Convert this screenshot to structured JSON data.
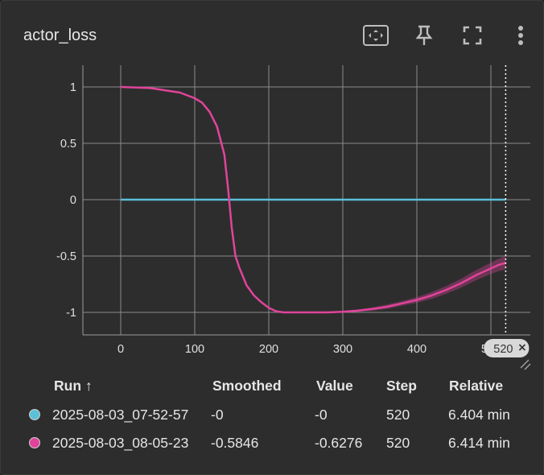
{
  "card": {
    "title": "actor_loss"
  },
  "toolbar": {
    "fit_icon": "fit-domain-icon",
    "pin_icon": "pin-icon",
    "fullscreen_icon": "fullscreen-icon",
    "more_icon": "more-vert-icon"
  },
  "chart_data": {
    "type": "line",
    "title": "actor_loss",
    "xlabel": "",
    "ylabel": "",
    "xlim": [
      -50,
      550
    ],
    "ylim": [
      -1.2,
      1.2
    ],
    "x_ticks": [
      "0",
      "100",
      "200",
      "300",
      "400",
      "500"
    ],
    "y_ticks": [
      "1",
      "0.5",
      "0",
      "-0.5",
      "-1"
    ],
    "grid": true,
    "cursor_step": 520,
    "cursor_label": "520",
    "series": [
      {
        "color": "#5bc0d8",
        "x": [
          0,
          520
        ],
        "y": [
          0,
          0
        ]
      },
      {
        "color": "#e0449a",
        "x": [
          0,
          40,
          80,
          100,
          110,
          120,
          130,
          140,
          145,
          150,
          155,
          160,
          170,
          180,
          190,
          200,
          210,
          220,
          240,
          260,
          280,
          300,
          320,
          340,
          360,
          380,
          400,
          420,
          440,
          460,
          480,
          500,
          510,
          520
        ],
        "y": [
          1.0,
          0.99,
          0.95,
          0.9,
          0.86,
          0.78,
          0.65,
          0.4,
          0.1,
          -0.25,
          -0.5,
          -0.6,
          -0.76,
          -0.85,
          -0.91,
          -0.96,
          -0.99,
          -1.0,
          -1.0,
          -1.0,
          -1.0,
          -0.995,
          -0.985,
          -0.97,
          -0.95,
          -0.92,
          -0.89,
          -0.85,
          -0.8,
          -0.74,
          -0.67,
          -0.61,
          -0.58,
          -0.56
        ],
        "band": [
          0,
          0,
          0,
          0.01,
          0.01,
          0.01,
          0.015,
          0.02,
          0.02,
          0.02,
          0.02,
          0.015,
          0.01,
          0.01,
          0.01,
          0.005,
          0.005,
          0,
          0,
          0,
          0,
          0.01,
          0.01,
          0.015,
          0.02,
          0.02,
          0.025,
          0.03,
          0.035,
          0.04,
          0.045,
          0.05,
          0.055,
          0.06
        ]
      }
    ]
  },
  "table": {
    "headers": {
      "run": "Run ↑",
      "smoothed": "Smoothed",
      "value": "Value",
      "step": "Step",
      "relative": "Relative"
    },
    "rows": [
      {
        "color": "#5bc0d8",
        "run": "2025-08-03_07-52-57",
        "smoothed": "-0",
        "value": "-0",
        "step": "520",
        "relative": "6.404 min"
      },
      {
        "color": "#e0449a",
        "run": "2025-08-03_08-05-23",
        "smoothed": "-0.5846",
        "value": "-0.6276",
        "step": "520",
        "relative": "6.414 min"
      }
    ]
  }
}
